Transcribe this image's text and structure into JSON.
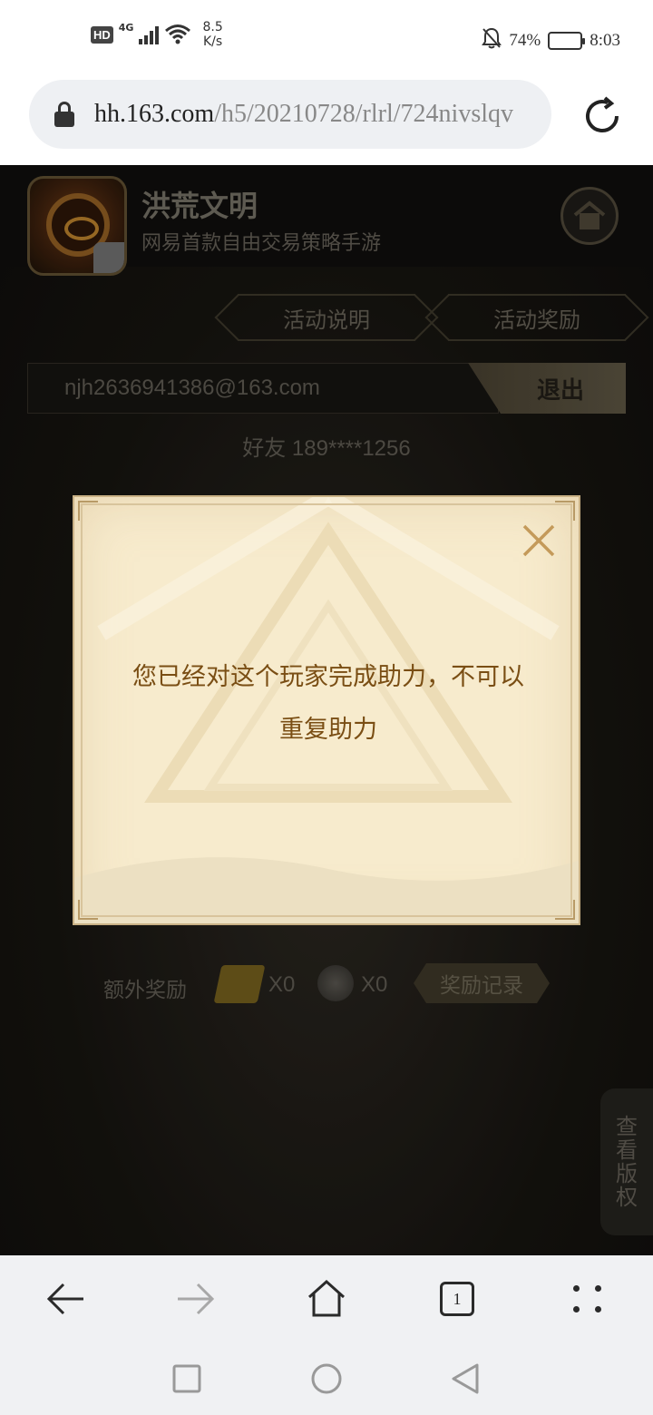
{
  "status_bar": {
    "hd": "HD",
    "network": "4G",
    "speed_value": "8.5",
    "speed_unit": "K/s",
    "battery": "74%",
    "battery_level": 0.74,
    "time": "8:03"
  },
  "browser": {
    "url_host": "hh.163.com",
    "url_path": "/h5/20210728/rlrl/724nivslqv"
  },
  "page": {
    "app_title": "洪荒文明",
    "app_subtitle": "网易首款自由交易策略手游",
    "tabs": [
      "活动说明",
      "活动奖励"
    ],
    "account_email": "njh2636941386@163.com",
    "logout_label": "退出",
    "friend_label": "好友 189****1256",
    "bonus": {
      "label": "额外奖励",
      "count1": "X0",
      "count2": "X0",
      "record_label": "奖励记录"
    },
    "copyright_label": [
      "查",
      "看",
      "版",
      "权"
    ]
  },
  "modal": {
    "message_line1": "您已经对这个玩家完成助力，不可以",
    "message_line2": "重复助力"
  },
  "bottom_nav": {
    "tab_count": "1"
  },
  "colors": {
    "modal_bg": "#f7ebcd",
    "modal_text": "#7a4e14",
    "page_bg": "#151411"
  }
}
